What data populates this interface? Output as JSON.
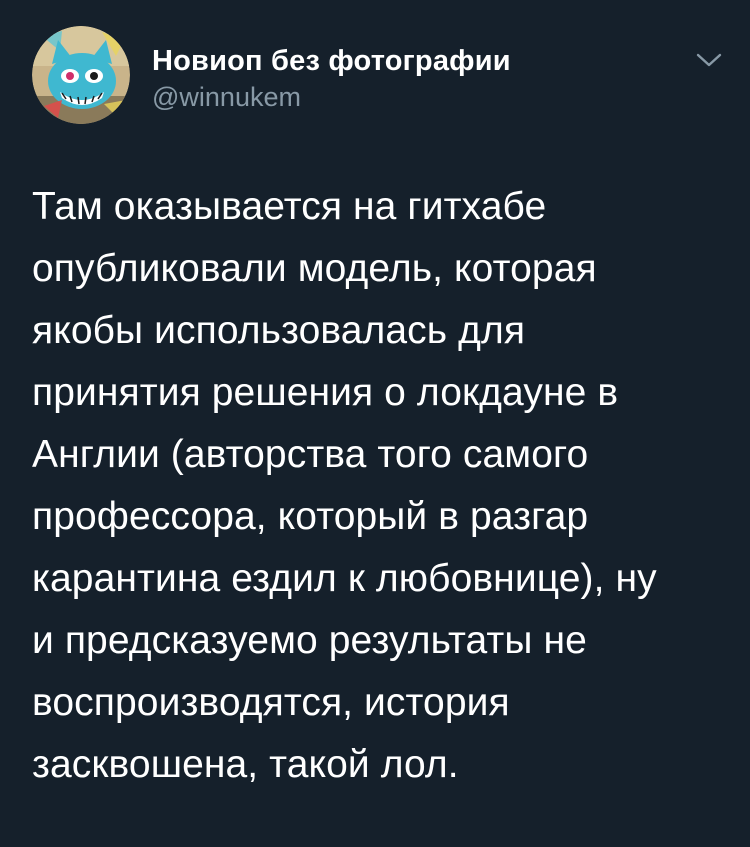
{
  "user": {
    "display_name": "Новиоп без фотографии",
    "handle": "@winnukem",
    "avatar_icon": "graffiti-cat-avatar"
  },
  "menu": {
    "icon": "chevron-down-icon"
  },
  "tweet": {
    "lines": [
      "Там оказывается на гитхабе",
      "опубликовали модель, которая",
      "якобы использовалась для",
      "принятия решения о локдауне в",
      "Англии (авторства того самого",
      "профессора, который в разгар",
      "карантина ездил к любовнице), ну",
      "и предсказуемо результаты не",
      "воспроизводятся, история",
      "засквошена, такой лол."
    ]
  },
  "colors": {
    "background": "#15202b",
    "text": "#ffffff",
    "secondary_text": "#8899a6"
  }
}
